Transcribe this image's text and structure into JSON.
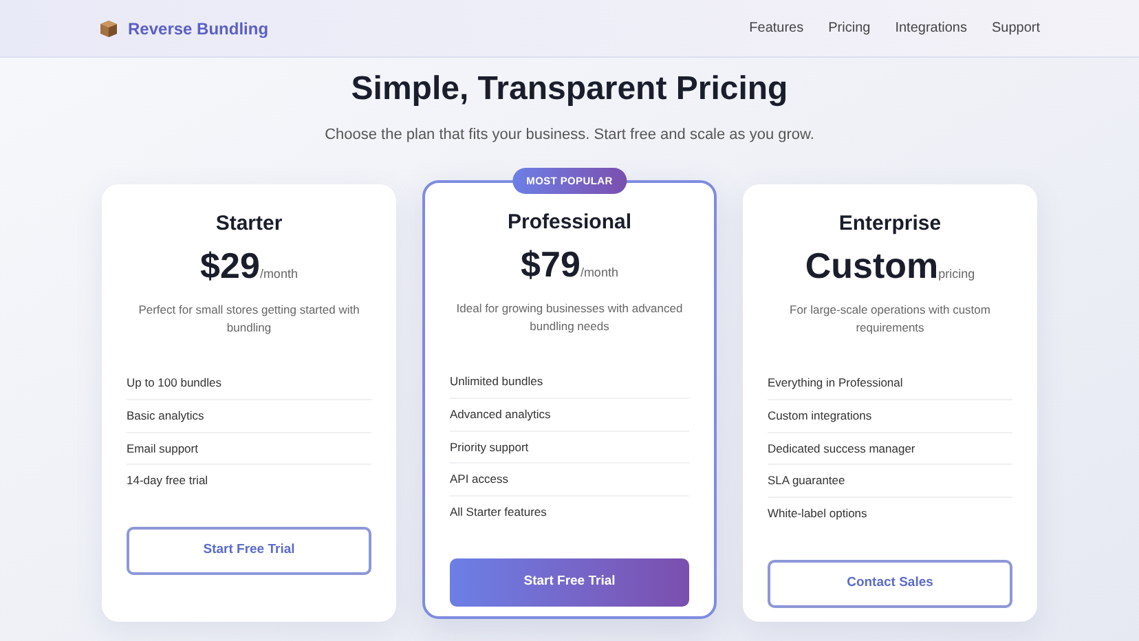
{
  "header": {
    "brand": "Reverse Bundling",
    "nav": [
      "Features",
      "Pricing",
      "Integrations",
      "Support"
    ]
  },
  "hero": {
    "title": "Simple, Transparent Pricing",
    "subtitle": "Choose the plan that fits your business. Start free and scale as you grow."
  },
  "plans": [
    {
      "name": "Starter",
      "price": "$29",
      "period": "/month",
      "description": "Perfect for small stores getting started with bundling",
      "features": [
        "Up to 100 bundles",
        "Basic analytics",
        "Email support",
        "14-day free trial"
      ],
      "cta": {
        "label": "Start Free Trial",
        "kind": "outline"
      },
      "featured": false
    },
    {
      "name": "Professional",
      "badge": "MOST POPULAR",
      "price": "$79",
      "period": "/month",
      "description": "Ideal for growing businesses with advanced bundling needs",
      "features": [
        "Unlimited bundles",
        "Advanced analytics",
        "Priority support",
        "API access",
        "All Starter features"
      ],
      "cta": {
        "label": "Start Free Trial",
        "kind": "primary"
      },
      "featured": true
    },
    {
      "name": "Enterprise",
      "price": "Custom",
      "period": "pricing",
      "description": "For large-scale operations with custom requirements",
      "features": [
        "Everything in Professional",
        "Custom integrations",
        "Dedicated success manager",
        "SLA guarantee",
        "White-label options"
      ],
      "cta": {
        "label": "Contact Sales",
        "kind": "outline"
      },
      "featured": false
    }
  ]
}
